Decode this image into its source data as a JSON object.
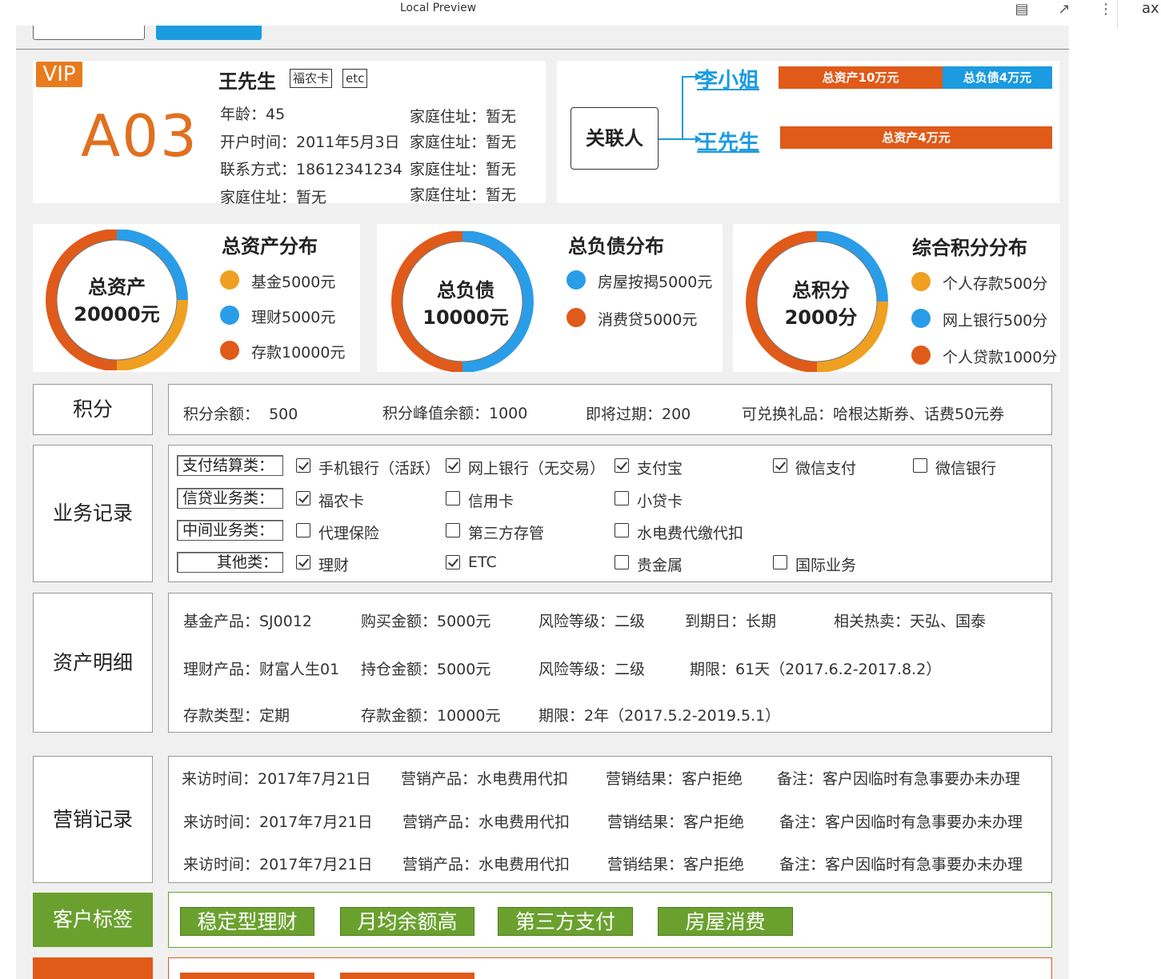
{
  "window": {
    "title": "Local Preview",
    "side_text": "ax"
  },
  "profile": {
    "badge": "VIP",
    "code": "A03",
    "name": "王先生",
    "tags": [
      "福农卡",
      "etc"
    ],
    "left_info": [
      "年龄：45",
      "开户时间：2011年5月3日",
      "联系方式：18612341234",
      "家庭住址：暂无"
    ],
    "right_info": [
      "家庭住址：暂无",
      "家庭住址：暂无",
      "家庭住址：暂无",
      "家庭住址：暂无"
    ]
  },
  "relations": {
    "label": "关联人",
    "people": [
      {
        "name": "李小姐",
        "asset": "总资产10万元",
        "liability": "总负债4万元",
        "asset_share": 0.6
      },
      {
        "name": "王先生",
        "asset": "总资产4万元",
        "liability": "",
        "asset_share": 1.0
      }
    ],
    "colors": {
      "asset": "#e05a1a",
      "liability": "#1b9be0",
      "link": "#1b9be0"
    }
  },
  "distributions": [
    {
      "title": "总资产分布",
      "center_line1": "总资产",
      "center_line2": "20000元",
      "items": [
        {
          "label": "基金5000元",
          "color": "#f0a020",
          "value": 5000
        },
        {
          "label": "理财5000元",
          "color": "#2a9de8",
          "value": 5000
        },
        {
          "label": "存款10000元",
          "color": "#e05a1a",
          "value": 10000
        }
      ],
      "ring_order": [
        "理财5000元",
        "基金5000元",
        "存款10000元"
      ]
    },
    {
      "title": "总负债分布",
      "center_line1": "总负债",
      "center_line2": "10000元",
      "items": [
        {
          "label": "房屋按揭5000元",
          "color": "#2a9de8",
          "value": 5000
        },
        {
          "label": "消费贷5000元",
          "color": "#e05a1a",
          "value": 5000
        }
      ],
      "ring_order": [
        "房屋按揭5000元",
        "消费贷5000元"
      ]
    },
    {
      "title": "综合积分分布",
      "center_line1": "总积分",
      "center_line2": "2000分",
      "items": [
        {
          "label": "个人存款500分",
          "color": "#f0a020",
          "value": 500
        },
        {
          "label": "网上银行500分",
          "color": "#2a9de8",
          "value": 500
        },
        {
          "label": "个人贷款1000分",
          "color": "#e05a1a",
          "value": 1000
        }
      ],
      "ring_order": [
        "网上银行500分",
        "个人存款500分",
        "个人贷款1000分"
      ]
    }
  ],
  "points": {
    "label": "积分",
    "balance": "积分余额：  500",
    "peak": "积分峰值余额：1000",
    "expiring": "即将过期：200",
    "gifts": "可兑换礼品：哈根达斯券、话费50元券"
  },
  "business": {
    "label": "业务记录",
    "rows": [
      {
        "category": "支付结算类：",
        "items": [
          {
            "label": "手机银行（活跃）",
            "checked": true
          },
          {
            "label": "网上银行（无交易）",
            "checked": true
          },
          {
            "label": "支付宝",
            "checked": true
          },
          {
            "label": "微信支付",
            "checked": true
          },
          {
            "label": "微信银行",
            "checked": false
          }
        ]
      },
      {
        "category": "信贷业务类：",
        "items": [
          {
            "label": "福农卡",
            "checked": true
          },
          {
            "label": "信用卡",
            "checked": false
          },
          {
            "label": "小贷卡",
            "checked": false
          }
        ]
      },
      {
        "category": "中间业务类：",
        "items": [
          {
            "label": "代理保险",
            "checked": false
          },
          {
            "label": "第三方存管",
            "checked": false
          },
          {
            "label": "水电费代缴代扣",
            "checked": false
          }
        ]
      },
      {
        "category": "其他类：",
        "items": [
          {
            "label": "理财",
            "checked": true
          },
          {
            "label": "ETC",
            "checked": true
          },
          {
            "label": "贵金属",
            "checked": false
          },
          {
            "label": "国际业务",
            "checked": false
          }
        ]
      }
    ]
  },
  "assets": {
    "label": "资产明细",
    "rows": [
      [
        "基金产品：SJ0012",
        "购买金额：5000元",
        "风险等级：二级",
        "到期日：长期",
        "相关热卖：天弘、国泰"
      ],
      [
        "理财产品：财富人生01",
        "持仓金额：5000元",
        "风险等级：二级",
        "期限：61天（2017.6.2-2017.8.2）"
      ],
      [
        "存款类型：定期",
        "存款金额：10000元",
        "期限：2年（2017.5.2-2019.5.1）"
      ]
    ]
  },
  "marketing": {
    "label": "营销记录",
    "rows": [
      [
        "来访时间：2017年7月21日",
        "营销产品：水电费用代扣",
        "营销结果：客户拒绝",
        "备注：客户因临时有急事要办未办理"
      ],
      [
        "来访时间：2017年7月21日",
        "营销产品：水电费用代扣",
        "营销结果：客户拒绝",
        "备注：客户因临时有急事要办未办理"
      ],
      [
        "来访时间：2017年7月21日",
        "营销产品：水电费用代扣",
        "营销结果：客户拒绝",
        "备注：客户因临时有急事要办未办理"
      ]
    ]
  },
  "customer_tags": {
    "label": "客户标签",
    "tags": [
      "稳定型理财",
      "月均余额高",
      "第三方支付",
      "房屋消费"
    ],
    "color": "#6aa12e"
  },
  "recommend": {
    "color": "#e05a1a"
  }
}
